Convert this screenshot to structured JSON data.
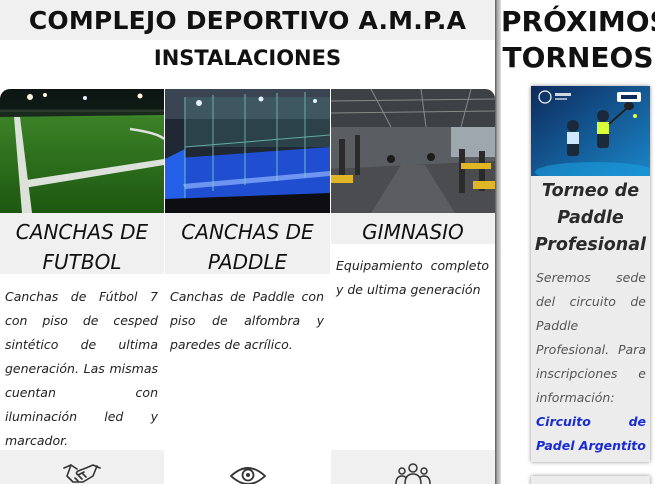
{
  "header": {
    "site_title": "COMPLEJO DEPORTIVO A.M.P.A",
    "section_title": "INSTALACIONES"
  },
  "facilities": [
    {
      "title": "CANCHAS DE FUTBOL",
      "description": "Canchas de Fútbol 7 con piso de cesped sintético de ultima generación. Las mismas cuentan con iluminación led y marcador.",
      "icon": "handshake-icon"
    },
    {
      "title": "CANCHAS DE PADDLE",
      "description": "Canchas de Paddle con piso de alfombra y paredes de acrílico.",
      "icon": "eye-icon"
    },
    {
      "title": "GIMNASIO",
      "description": "Equipamiento completo y de ultima generación",
      "icon": "users-icon"
    }
  ],
  "sidebar": {
    "title": "PRÓXIMOS TORNEOS",
    "tournament": {
      "title": "Torneo de Paddle Profesional",
      "description": "Seremos sede del circuito de Paddle Profesional. Para inscripciones e información:",
      "link_label": "Circuito de Padel Argentito"
    }
  },
  "colors": {
    "panel_gray": "#f0f0f0",
    "link_blue": "#1a2bd6",
    "turf_green": "#2f7d1e",
    "paddle_blue": "#1f4fd0"
  }
}
